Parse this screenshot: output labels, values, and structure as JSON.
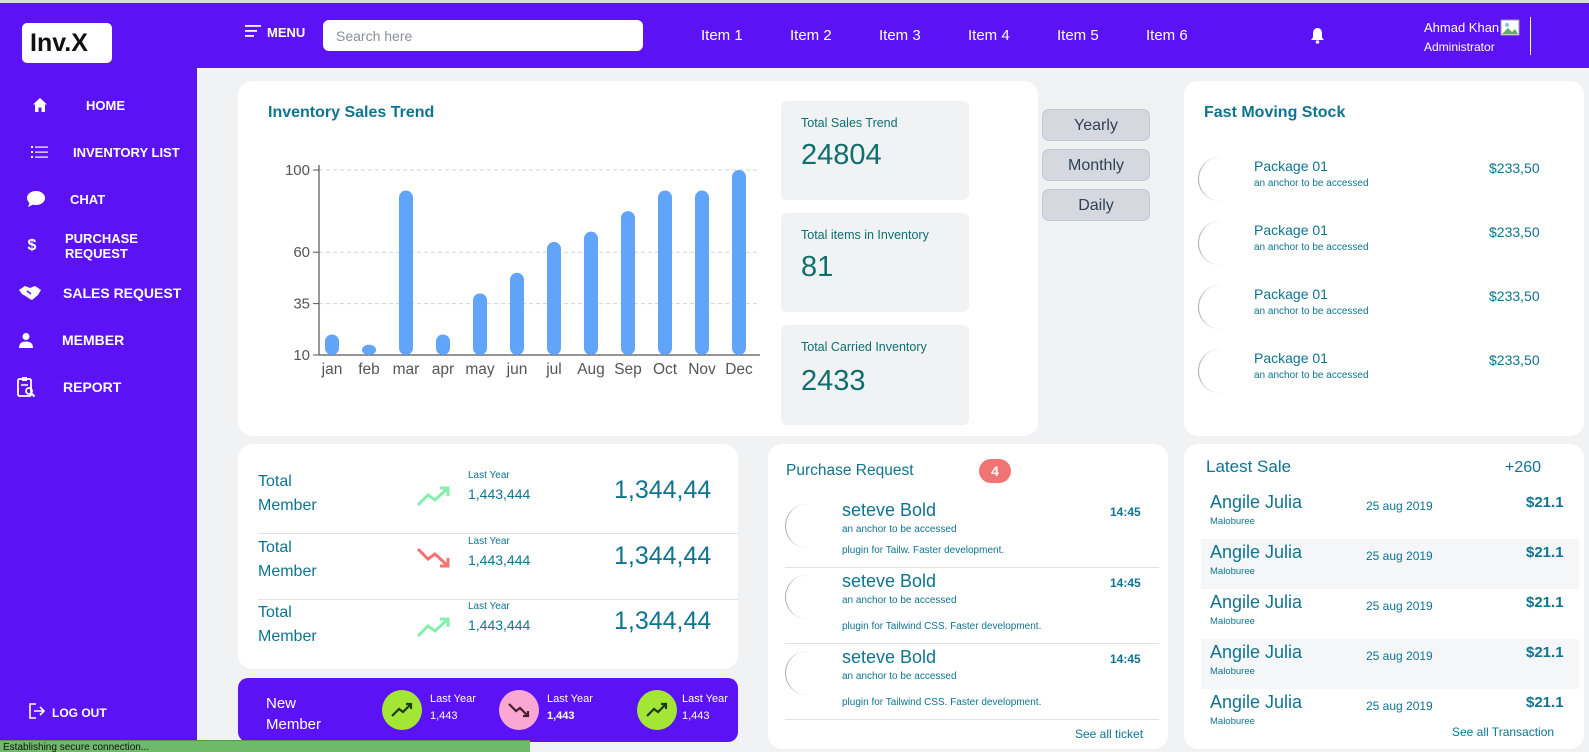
{
  "app": {
    "logo": "Inv.X"
  },
  "sidebar": {
    "items": [
      {
        "label": "HOME",
        "icon": "home-icon"
      },
      {
        "label": "INVENTORY LIST",
        "icon": "list-icon"
      },
      {
        "label": "CHAT",
        "icon": "chat-icon"
      },
      {
        "label": "PURCHASE REQUEST",
        "icon": "dollar-icon"
      },
      {
        "label": "SALES REQUEST",
        "icon": "handshake-icon"
      },
      {
        "label": "MEMBER",
        "icon": "user-icon"
      },
      {
        "label": "REPORT",
        "icon": "report-icon"
      }
    ],
    "logout": "LOG OUT"
  },
  "topbar": {
    "menu_label": "MENU",
    "search_placeholder": "Search here",
    "items": [
      "Item 1",
      "Item 2",
      "Item 3",
      "Item 4",
      "Item 5",
      "Item 6"
    ],
    "user_name": "Ahmad Khan",
    "user_role": "Administrator"
  },
  "sales_trend": {
    "title": "Inventory Sales Trend",
    "chart_data": {
      "type": "bar",
      "categories": [
        "jan",
        "feb",
        "mar",
        "apr",
        "may",
        "jun",
        "jul",
        "Aug",
        "Sep",
        "Oct",
        "Nov",
        "Dec"
      ],
      "values": [
        20,
        15,
        90,
        20,
        40,
        50,
        65,
        70,
        80,
        90,
        90,
        100
      ],
      "yticks": [
        10,
        35,
        60,
        100
      ],
      "ylim": [
        10,
        100
      ],
      "grid": true,
      "bar_color": "#60a5fa"
    }
  },
  "stats": {
    "total_sales_label": "Total Sales Trend",
    "total_sales_value": "24804",
    "total_items_label": "Total items in Inventory",
    "total_items_value": "81",
    "carried_label": "Total Carried Inventory",
    "carried_value": "2433"
  },
  "periods": [
    "Yearly",
    "Monthly",
    "Daily"
  ],
  "fast_moving": {
    "title": "Fast Moving Stock",
    "items": [
      {
        "name": "Package 01",
        "sub": "an anchor to be accessed",
        "price": "$233,50"
      },
      {
        "name": "Package 01",
        "sub": "an anchor to be accessed",
        "price": "$233,50"
      },
      {
        "name": "Package 01",
        "sub": "an anchor to be accessed",
        "price": "$233,50"
      },
      {
        "name": "Package 01",
        "sub": "an anchor to be accessed",
        "price": "$233,50"
      }
    ]
  },
  "members": {
    "rows": [
      {
        "title": "Total Member",
        "trend": "up",
        "last_year_label": "Last Year",
        "last_year_value": "1,443,444",
        "value": "1,344,44"
      },
      {
        "title": "Total Member",
        "trend": "down",
        "last_year_label": "Last Year",
        "last_year_value": "1,443,444",
        "value": "1,344,44"
      },
      {
        "title": "Total Member",
        "trend": "up",
        "last_year_label": "Last Year",
        "last_year_value": "1,443,444",
        "value": "1,344,44"
      }
    ]
  },
  "new_member": {
    "title": "New Member",
    "items": [
      {
        "label": "Last Year",
        "value": "1,443",
        "trend": "up"
      },
      {
        "label": "Last Year",
        "value": "1,443",
        "trend": "down"
      },
      {
        "label": "Last Year",
        "value": "1,443",
        "trend": "up"
      }
    ]
  },
  "purchase_request": {
    "title": "Purchase Request",
    "badge": "4",
    "items": [
      {
        "name": "seteve Bold",
        "sub1": "an anchor to be accessed",
        "sub2": "plugin for Tailw. Faster development.",
        "time": "14:45"
      },
      {
        "name": "seteve Bold",
        "sub1": "an anchor to be accessed",
        "sub2": "plugin for Tailwind CSS. Faster development.",
        "time": "14:45"
      },
      {
        "name": "seteve Bold",
        "sub1": "an anchor to be accessed",
        "sub2": "plugin for Tailwind CSS. Faster development.",
        "time": "14:45"
      }
    ],
    "see_all": "See all ticket"
  },
  "latest_sale": {
    "title": "Latest Sale",
    "count": "+260",
    "items": [
      {
        "name": "Angile Julia",
        "sub": "Maloburee",
        "date": "25 aug 2019",
        "amount": "$21.1"
      },
      {
        "name": "Angile Julia",
        "sub": "Maloburee",
        "date": "25 aug 2019",
        "amount": "$21.1"
      },
      {
        "name": "Angile Julia",
        "sub": "Maloburee",
        "date": "25 aug 2019",
        "amount": "$21.1"
      },
      {
        "name": "Angile Julia",
        "sub": "Maloburee",
        "date": "25 aug 2019",
        "amount": "$21.1"
      },
      {
        "name": "Angile Julia",
        "sub": "Maloburee",
        "date": "25 aug 2019",
        "amount": "$21.1"
      }
    ],
    "see_all": "See all Transaction"
  },
  "status_bar": "Establishing secure connection...",
  "colors": {
    "brand": "#5b13f5",
    "teal": "#0e7490",
    "bar": "#60a5fa",
    "up": "#86efac",
    "down": "#f87171",
    "badge": "#f17474"
  }
}
